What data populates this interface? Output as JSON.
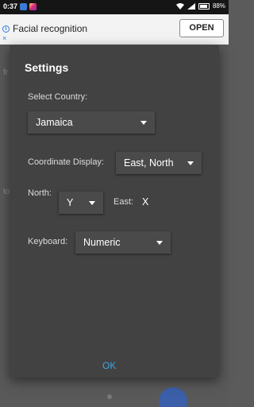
{
  "status_bar": {
    "time": "0:37",
    "battery": "88%"
  },
  "ad": {
    "info_icon": "i",
    "close_icon": "×",
    "text": "Facial recognition",
    "button": "OPEN"
  },
  "background": {
    "text1": "fr",
    "text2": "to"
  },
  "dialog": {
    "title": "Settings",
    "select_country_label": "Select Country:",
    "country_value": "Jamaica",
    "coordinate_display_label": "Coordinate Display:",
    "coordinate_display_value": "East, North",
    "north_label": "North:",
    "north_value": "Y",
    "east_label": "East:",
    "east_value": "X",
    "keyboard_label": "Keyboard:",
    "keyboard_value": "Numeric",
    "ok_button": "OK"
  },
  "colors": {
    "dialog_bg": "#424242",
    "accent": "#3aa7e6"
  }
}
